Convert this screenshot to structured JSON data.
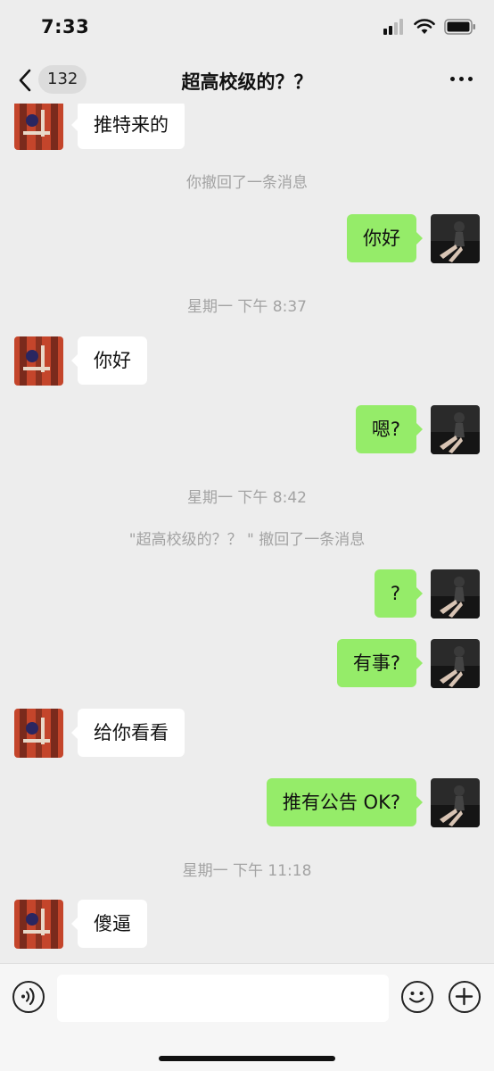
{
  "status_bar": {
    "time": "7:33"
  },
  "nav": {
    "back_count": "132",
    "title": "超高校级的？？"
  },
  "messages": [
    {
      "type": "received",
      "text": "推特来的"
    },
    {
      "type": "system",
      "text": "你撤回了一条消息"
    },
    {
      "type": "sent",
      "text": "你好"
    },
    {
      "type": "system",
      "text": "星期一 下午 8:37"
    },
    {
      "type": "received",
      "text": "你好"
    },
    {
      "type": "sent",
      "text": "嗯?"
    },
    {
      "type": "system",
      "text": "星期一 下午 8:42"
    },
    {
      "type": "system",
      "text": "\"超高校级的？？ \" 撤回了一条消息"
    },
    {
      "type": "sent",
      "text": "?"
    },
    {
      "type": "sent",
      "text": "有事?"
    },
    {
      "type": "received",
      "text": "给你看看"
    },
    {
      "type": "sent",
      "text": "推有公告 OK?"
    },
    {
      "type": "system",
      "text": "星期一 下午 11:18"
    },
    {
      "type": "received",
      "text": "傻逼"
    }
  ],
  "input_bar": {
    "voice_icon": "voice-icon",
    "emoji_icon": "emoji-icon",
    "add_icon": "plus-icon"
  },
  "colors": {
    "sent_bubble": "#95ec69",
    "received_bubble": "#ffffff",
    "background": "#ededed"
  }
}
